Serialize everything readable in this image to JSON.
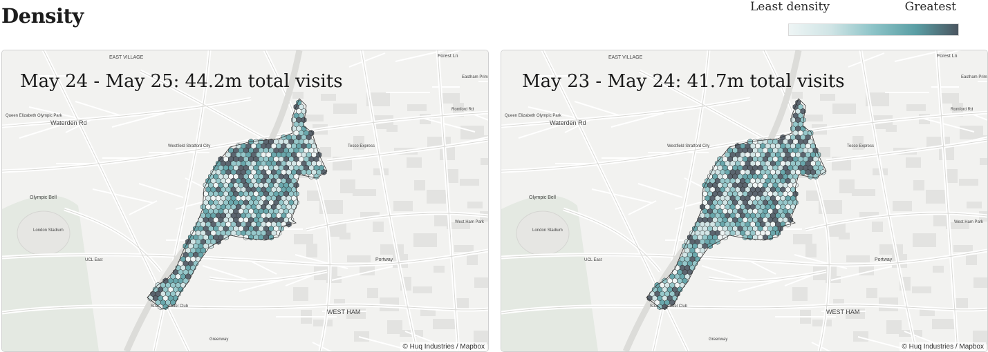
{
  "page": {
    "title": "Density"
  },
  "legend": {
    "low_label": "Least density",
    "high_label": "Greatest",
    "colors": [
      "#eef5f5",
      "#cfe4e5",
      "#8cc3c7",
      "#5a9ea4",
      "#4a5560"
    ]
  },
  "maps": [
    {
      "caption": "May 24 - May 25: 44.2m total visits",
      "attribution": "© Huq Industries / Mapbox",
      "variant": "a"
    },
    {
      "caption": "May 23 - May 24: 41.7m total visits",
      "attribution": "© Huq Industries / Mapbox",
      "variant": "b"
    }
  ],
  "place_labels": [
    "EAST VILLAGE",
    "Waterden Rd",
    "Queen Elizabeth Olympic Park",
    "Olympic Bell",
    "London Stadium",
    "UCL East",
    "Westfield Stratford City",
    "Stratford Padel Club",
    "WEST HAM",
    "Tesco Express",
    "West Ham Park",
    "Forest Ln",
    "Eastham Primary School",
    "Romford Rd",
    "Portway",
    "Greenway"
  ]
}
